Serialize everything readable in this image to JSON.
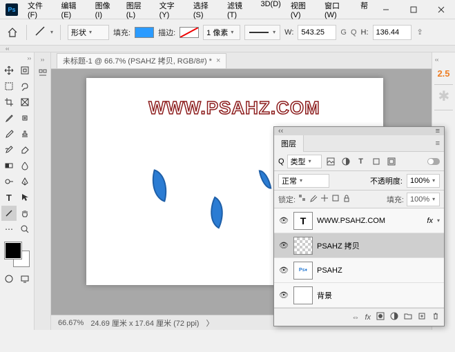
{
  "titlebar": {
    "app": "Ps"
  },
  "menu": [
    "文件(F)",
    "编辑(E)",
    "图像(I)",
    "图层(L)",
    "文字(Y)",
    "选择(S)",
    "滤镜(T)",
    "3D(D)",
    "视图(V)",
    "窗口(W)",
    "帮"
  ],
  "optbar": {
    "shape_label": "形状",
    "fill_label": "填充:",
    "stroke_label": "描边:",
    "stroke_width": "1 像素",
    "w_label": "W:",
    "w_value": "543.25",
    "link_label": "⇔",
    "h_label": "H:",
    "h_value": "136.44"
  },
  "doc_tab": {
    "title": "未标题-1 @ 66.7% (PSAHZ 拷贝, RGB/8#) *"
  },
  "statusbar": {
    "zoom": "66.67%",
    "dims": "24.69 厘米 x 17.64 厘米 (72 ppi)",
    "chev": "〉"
  },
  "watermark": "WWW.PSAHZ.COM",
  "right": {
    "num": "2.5"
  },
  "layers": {
    "title": "图层",
    "filter_label": "类型",
    "search_icon": "Q",
    "blend_mode": "正常",
    "opacity_label": "不透明度:",
    "opacity_value": "100%",
    "lock_label": "锁定:",
    "fill_label": "填充:",
    "fill_value": "100%",
    "items": [
      {
        "visible": true,
        "type": "T",
        "name": "WWW.PSAHZ.COM",
        "fx": "fx"
      },
      {
        "visible": true,
        "type": "trans",
        "name": "PSAHZ 拷贝",
        "selected": true
      },
      {
        "visible": true,
        "type": "img",
        "name": "PSAHZ"
      },
      {
        "visible": true,
        "type": "blank",
        "name": "背景"
      }
    ],
    "menu_icon": "≡"
  }
}
